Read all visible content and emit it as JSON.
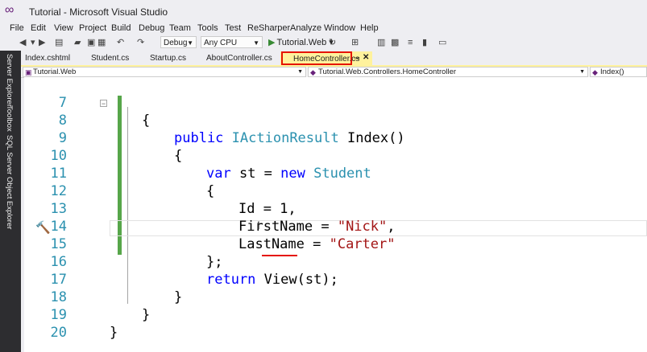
{
  "window": {
    "title": "Tutorial - Microsoft Visual Studio",
    "logo_icon": "visual-studio-logo-icon"
  },
  "menu": [
    "File",
    "Edit",
    "View",
    "Project",
    "Build",
    "Debug",
    "Team",
    "Tools",
    "Test",
    "ReSharper",
    "Analyze",
    "Window",
    "Help"
  ],
  "toolbar": {
    "config": "Debug",
    "platform": "Any CPU",
    "run_label": "Tutorial.Web"
  },
  "side_tabs": [
    "Server Explorer",
    "Toolbox",
    "SQL Server Object Explorer"
  ],
  "tabs": [
    "Index.cshtml",
    "Student.cs",
    "Startup.cs",
    "AboutController.cs",
    "HomeController.cs"
  ],
  "active_tab": "HomeController.cs",
  "nav": {
    "project": "Tutorial.Web",
    "class": "Tutorial.Web.Controllers.HomeController",
    "member": "Index()"
  },
  "code": {
    "line_numbers": [
      "7",
      "8",
      "9",
      "10",
      "11",
      "12",
      "13",
      "14",
      "15",
      "16",
      "17",
      "18",
      "19",
      "20"
    ],
    "l7": "{",
    "l8_kw": "public",
    "l8_type": "IActionResult",
    "l8_rest": " Index()",
    "l9": "{",
    "l10_kw1": "var",
    "l10_mid": " st = ",
    "l10_kw2": "new",
    "l10_type": "Student",
    "l11": "{",
    "l12": "Id = 1,",
    "l13_a": "FirstName = ",
    "l13_str": "\"Nick\"",
    "l13_b": ",",
    "l14_a": "LastName = ",
    "l14_str": "\"Carter\"",
    "l15": "};",
    "l16_kw": "return",
    "l16_a": " ",
    "l16_view": "View",
    "l16_b": "(st);",
    "l17": "}",
    "l18": "}",
    "l19": "}"
  },
  "colors": {
    "keyword": "#0000ff",
    "type": "#2b91af",
    "string": "#a31515",
    "change_bar": "#57a64a",
    "active_tab": "#fff29d",
    "highlight_border": "#e51400"
  }
}
